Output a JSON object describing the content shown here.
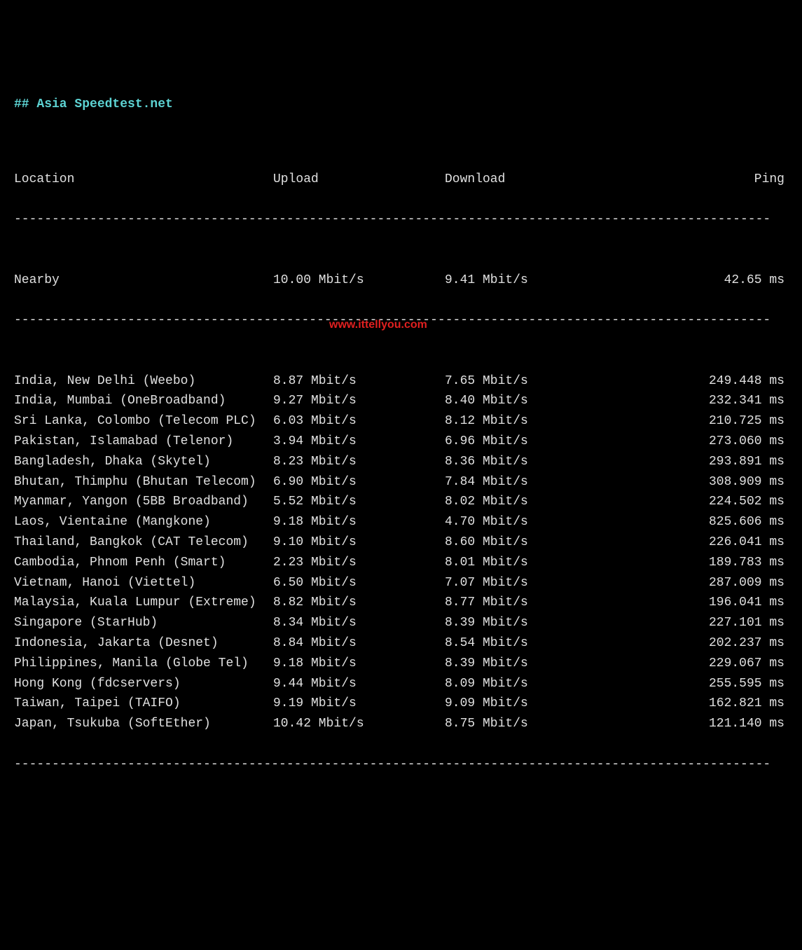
{
  "header": "## Asia Speedtest.net",
  "columns": {
    "location": "Location",
    "upload": "Upload",
    "download": "Download",
    "ping": "Ping"
  },
  "nearby": {
    "location": "Nearby",
    "upload": "10.00 Mbit/s",
    "download": "9.41 Mbit/s",
    "ping": "42.65 ms"
  },
  "rows": [
    {
      "location": "India, New Delhi (Weebo)",
      "upload": "8.87 Mbit/s",
      "download": "7.65 Mbit/s",
      "ping": "249.448 ms"
    },
    {
      "location": "India, Mumbai (OneBroadband)",
      "upload": "9.27 Mbit/s",
      "download": "8.40 Mbit/s",
      "ping": "232.341 ms"
    },
    {
      "location": "Sri Lanka, Colombo (Telecom PLC)",
      "upload": "6.03 Mbit/s",
      "download": "8.12 Mbit/s",
      "ping": "210.725 ms"
    },
    {
      "location": "Pakistan, Islamabad (Telenor)",
      "upload": "3.94 Mbit/s",
      "download": "6.96 Mbit/s",
      "ping": "273.060 ms"
    },
    {
      "location": "Bangladesh, Dhaka (Skytel)",
      "upload": "8.23 Mbit/s",
      "download": "8.36 Mbit/s",
      "ping": "293.891 ms"
    },
    {
      "location": "Bhutan, Thimphu (Bhutan Telecom)",
      "upload": "6.90 Mbit/s",
      "download": "7.84 Mbit/s",
      "ping": "308.909 ms"
    },
    {
      "location": "Myanmar, Yangon (5BB Broadband)",
      "upload": "5.52 Mbit/s",
      "download": "8.02 Mbit/s",
      "ping": "224.502 ms"
    },
    {
      "location": "Laos, Vientaine (Mangkone)",
      "upload": "9.18 Mbit/s",
      "download": "4.70 Mbit/s",
      "ping": "825.606 ms"
    },
    {
      "location": "Thailand, Bangkok (CAT Telecom)",
      "upload": "9.10 Mbit/s",
      "download": "8.60 Mbit/s",
      "ping": "226.041 ms"
    },
    {
      "location": "Cambodia, Phnom Penh (Smart)",
      "upload": "2.23 Mbit/s",
      "download": "8.01 Mbit/s",
      "ping": "189.783 ms"
    },
    {
      "location": "Vietnam, Hanoi (Viettel)",
      "upload": "6.50 Mbit/s",
      "download": "7.07 Mbit/s",
      "ping": "287.009 ms"
    },
    {
      "location": "Malaysia, Kuala Lumpur (Extreme)",
      "upload": "8.82 Mbit/s",
      "download": "8.77 Mbit/s",
      "ping": "196.041 ms"
    },
    {
      "location": "Singapore (StarHub)",
      "upload": "8.34 Mbit/s",
      "download": "8.39 Mbit/s",
      "ping": "227.101 ms"
    },
    {
      "location": "Indonesia, Jakarta (Desnet)",
      "upload": "8.84 Mbit/s",
      "download": "8.54 Mbit/s",
      "ping": "202.237 ms"
    },
    {
      "location": "Philippines, Manila (Globe Tel)",
      "upload": "9.18 Mbit/s",
      "download": "8.39 Mbit/s",
      "ping": "229.067 ms"
    },
    {
      "location": "Hong Kong (fdcservers)",
      "upload": "9.44 Mbit/s",
      "download": "8.09 Mbit/s",
      "ping": "255.595 ms"
    },
    {
      "location": "Taiwan, Taipei (TAIFO)",
      "upload": "9.19 Mbit/s",
      "download": "9.09 Mbit/s",
      "ping": "162.821 ms"
    },
    {
      "location": "Japan, Tsukuba (SoftEther)",
      "upload": "10.42 Mbit/s",
      "download": "8.75 Mbit/s",
      "ping": "121.140 ms"
    }
  ],
  "watermark": "www.ittellyou.com",
  "divider": "----------------------------------------------------------------------------------------------------"
}
